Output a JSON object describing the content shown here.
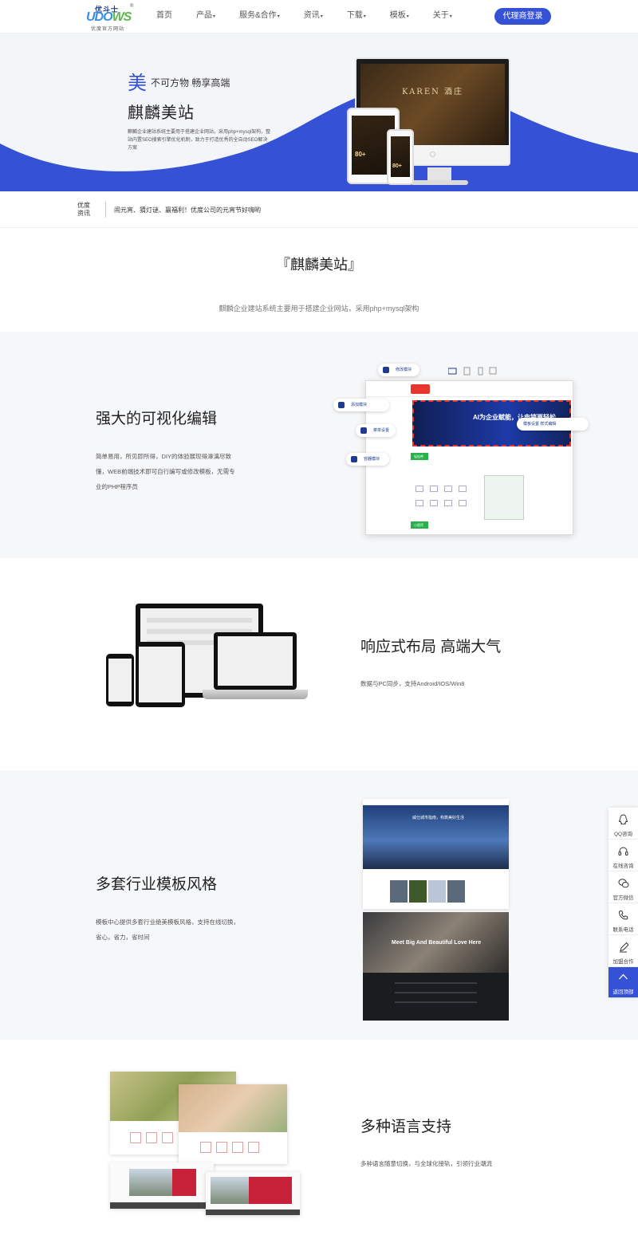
{
  "logo": {
    "top": "优斗士",
    "reg": "®",
    "word_a": "UDO",
    "word_b": "WS",
    "sub": "优度官方网站"
  },
  "nav": {
    "items": [
      {
        "label": "首页",
        "caret": ""
      },
      {
        "label": "产品",
        "caret": "▾"
      },
      {
        "label": "服务&合作",
        "caret": "▾"
      },
      {
        "label": "资讯",
        "caret": "▾"
      },
      {
        "label": "下载",
        "caret": "▾"
      },
      {
        "label": "模板",
        "caret": "▾"
      },
      {
        "label": "关于",
        "caret": "▾"
      }
    ],
    "login_label": "代理商登录"
  },
  "hero": {
    "mei": "美",
    "slogan": "不可方物 畅享高端",
    "title": "麒麟美站",
    "desc": "麒麟企业建站系统主要用于搭建企业网站，采用php+mysql架构，整站内置SEO搜索引擎优化机制，致力于打造优秀的全自动SEO解决方案",
    "monitor_brand": "KAREN 酒庄",
    "tablet_text": "80+",
    "phone_text": "80+"
  },
  "news": {
    "tag": "优度资讯",
    "text": "闹元宵、猜灯谜、赢福利！优度公司的元宵节好嗨哟"
  },
  "intro": {
    "title": "『麒麟美站』",
    "subtitle": "麒麟企业建站系统主要用于搭建企业网站，采用php+mysql架构"
  },
  "features": [
    {
      "title": "强大的可视化编辑",
      "desc": "简单易用，所见即所得，DIY的体验展现得淋漓尽致 懂，WEB前端技术即可自行编写或修改模板，无需专业的PHP程序员"
    },
    {
      "title": "响应式布局 高端大气",
      "desc": "数据与PC同步，支持Android/IOS/Win8"
    },
    {
      "title": "多套行业模板风格",
      "desc": "模板中心提供多套行业绝美模板风格，支持在线切换，省心，省力，省时间"
    },
    {
      "title": "多种语言支持",
      "desc": "多种语言随意切换，与全球化接轨，引领行业潮流"
    }
  ],
  "editor": {
    "pills": [
      "修改模块",
      "添加模块",
      "菜单设置",
      "容器模块"
    ],
    "toolbar_label": "模板设置  样式编辑",
    "banner_text": "AI为企业赋能，让电销更轻松",
    "green1": "轻松呼",
    "green2": "小程序"
  },
  "templates": {
    "a_text": "威仕城市指南，构筑美好生活",
    "b_text": "Meet Big And Beautiful Love Here"
  },
  "side": {
    "items": [
      {
        "label": "QQ咨询",
        "icon": "qq-icon"
      },
      {
        "label": "在线咨询",
        "icon": "headset-icon"
      },
      {
        "label": "官方微信",
        "icon": "wechat-icon"
      },
      {
        "label": "联系电话",
        "icon": "phone-icon"
      },
      {
        "label": "加盟合作",
        "icon": "pen-icon"
      }
    ],
    "top_label": "返回顶部"
  },
  "colors": {
    "primary": "#3551d6",
    "wave": "#3551d6",
    "accent_red": "#e8352e"
  }
}
